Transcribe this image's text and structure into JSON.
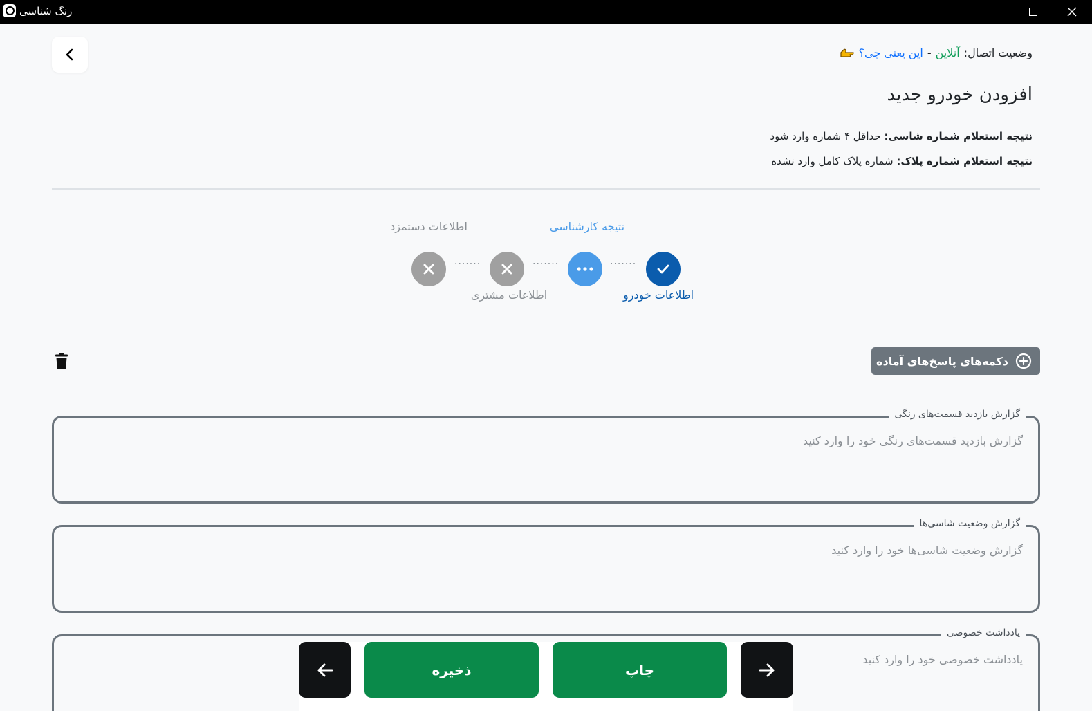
{
  "window": {
    "title": "رنگ شناسی"
  },
  "connection": {
    "label": "وضعیت اتصال:",
    "status": "آنلاین",
    "separator": "-",
    "help_link": "این یعنی چی؟"
  },
  "page": {
    "title": "افزودن خودرو جدید"
  },
  "inquiries": [
    {
      "label": "نتیجه استعلام شماره شاسی:",
      "value": "حداقل ۴ شماره وارد شود"
    },
    {
      "label": "نتیجه استعلام شماره پلاک:",
      "value": "شماره پلاک کامل وارد نشده"
    }
  ],
  "stepper": {
    "steps": [
      {
        "label": "اطلاعات خودرو",
        "state": "completed"
      },
      {
        "label": "نتیجه کارشناسی",
        "state": "active"
      },
      {
        "label": "اطلاعات مشتری",
        "state": "error"
      },
      {
        "label": "اطلاعات دستمزد",
        "state": "error"
      }
    ],
    "colors": {
      "completed": "#0b5cad",
      "active": "#4a9be8",
      "error": "#a0a0a0"
    }
  },
  "toolbar": {
    "ready_answers_label": "دکمه‌های پاسخ‌های آماده"
  },
  "fields": [
    {
      "legend": "گزارش بازدید قسمت‌های رنگی",
      "placeholder": "گزارش بازدید قسمت‌های رنگی خود را وارد کنید"
    },
    {
      "legend": "گزارش وضعیت شاسی‌ها",
      "placeholder": "گزارش وضعیت شاسی‌ها خود را وارد کنید"
    },
    {
      "legend": "یادداشت خصوصی",
      "placeholder": "یادداشت خصوصی خود را وارد کنید"
    }
  ],
  "actions": {
    "save_label": "ذخیره",
    "print_label": "چاپ"
  },
  "colors": {
    "primary_green": "#0a8a4a",
    "dark": "#111315",
    "online": "#0f9d58",
    "link": "#0d6efd"
  }
}
